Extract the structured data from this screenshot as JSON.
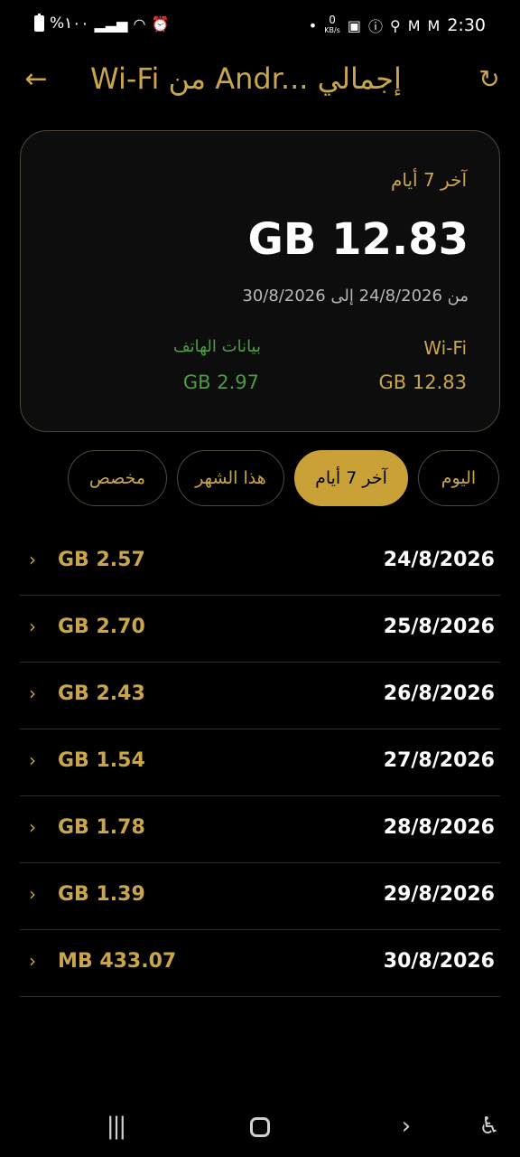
{
  "status_bar": {
    "battery": "%١٠٠",
    "time": "2:30",
    "speed_value": "0",
    "speed_unit": "KB/s"
  },
  "app_bar": {
    "title": "Wi-Fi من Andr... إجمالي"
  },
  "summary": {
    "period_label": "آخر 7 أيام",
    "total": "GB 12.83",
    "date_range": "من 24/8/2026 إلى 30/8/2026",
    "wifi_label": "Wi-Fi",
    "wifi_value": "GB 12.83",
    "mobile_label": "بيانات الهاتف",
    "mobile_value": "GB 2.97"
  },
  "filters": {
    "today": "اليوم",
    "last7": "آخر 7 أيام",
    "this_month": "هذا الشهر",
    "custom": "مخصص",
    "selected": "last7"
  },
  "usage_rows": [
    {
      "date": "24/8/2026",
      "value": "GB 2.57"
    },
    {
      "date": "25/8/2026",
      "value": "GB 2.70"
    },
    {
      "date": "26/8/2026",
      "value": "GB 2.43"
    },
    {
      "date": "27/8/2026",
      "value": "GB 1.54"
    },
    {
      "date": "28/8/2026",
      "value": "GB 1.78"
    },
    {
      "date": "29/8/2026",
      "value": "GB 1.39"
    },
    {
      "date": "30/8/2026",
      "value": "MB 433.07"
    }
  ],
  "colors": {
    "accent": "#c9a64a",
    "active_chip": "#c9a136",
    "mobile_green": "#4e9a46",
    "background": "#000000"
  }
}
